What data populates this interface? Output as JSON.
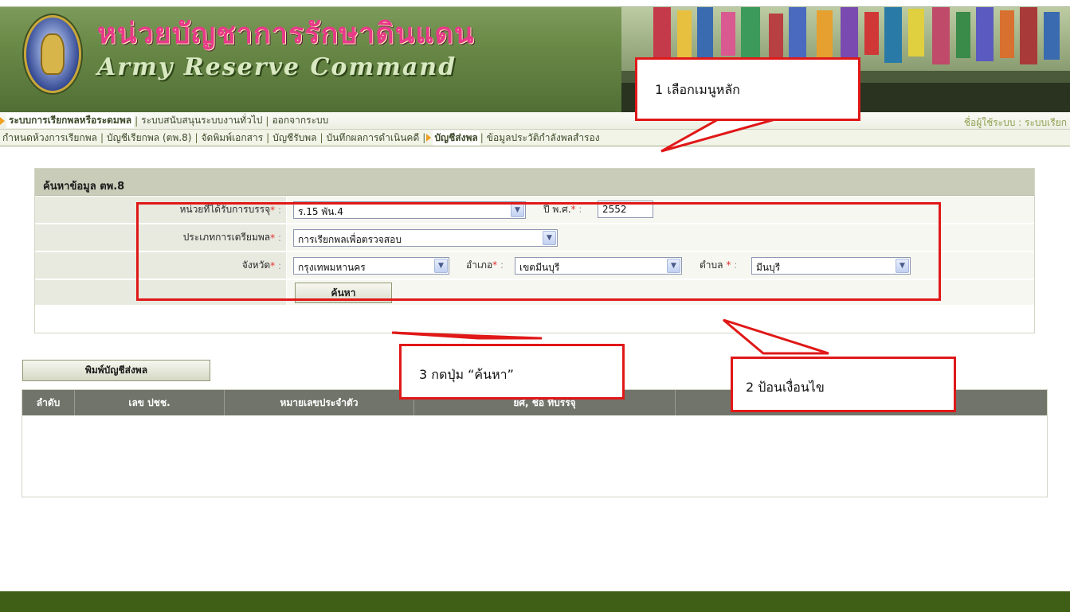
{
  "header": {
    "title_thai": "หน่วยบัญชาการรักษาดินแดน",
    "title_en": "Army Reserve Command"
  },
  "menu_primary": {
    "items": [
      {
        "label": "ระบบการเรียกพลหรือระดมพล",
        "active": true
      },
      {
        "label": "ระบบสนับสนุนระบบงานทั่วไป",
        "active": false
      },
      {
        "label": "ออกจากระบบ",
        "active": false
      }
    ],
    "user_label": "ชื่อผู้ใช้ระบบ : ระบบเรียก"
  },
  "menu_secondary": {
    "items": [
      {
        "label": "กำหนดห้วงการเรียกพล",
        "active": false
      },
      {
        "label": "บัญชีเรียกพล (ตพ.8)",
        "active": false
      },
      {
        "label": "จัดพิมพ์เอกสาร",
        "active": false
      },
      {
        "label": "บัญชีรับพล",
        "active": false
      },
      {
        "label": "บันทึกผลการดำเนินคดี",
        "active": false
      },
      {
        "label": "บัญชีส่งพล",
        "active": true
      },
      {
        "label": "ข้อมูลประวัติกำลังพลสำรอง",
        "active": false
      }
    ]
  },
  "search_panel": {
    "heading": "ค้นหาข้อมูล ตพ.8",
    "unit_label": "หน่วยที่ได้รับการบรรจุ",
    "unit_value": "ร.15 พัน.4",
    "year_label": "ปี พ.ศ.",
    "year_value": "2552",
    "prep_type_label": "ประเภทการเตรียมพล",
    "prep_type_value": "การเรียกพลเพื่อตรวจสอบ",
    "province_label": "จังหวัด",
    "province_value": "กรุงเทพมหานคร",
    "district_label": "อำเภอ",
    "district_value": "เขตมีนบุรี",
    "subdistrict_label": "ตำบล",
    "subdistrict_value": "มีนบุรี",
    "required_mark": "*",
    "colon": ":",
    "search_button": "ค้นหา"
  },
  "results": {
    "print_button": "พิมพ์บัญชีส่งพล",
    "columns": [
      "ลำดับ",
      "เลข ปชช.",
      "หมายเลขประจำตัว",
      "ยศ, ชื่อ ที่บรรจุ",
      ""
    ]
  },
  "annotations": {
    "step1": "1 เลือกเมนูหลัก",
    "step2": "2 ป้อนเงื่อนไข",
    "step3": "3 กดปุ่ม “ค้นหา”"
  },
  "colors": {
    "header_green": "#6a8a48",
    "footer_green": "#3f5f16",
    "annotation_red": "#e01818",
    "table_header_gray": "#71746a"
  }
}
